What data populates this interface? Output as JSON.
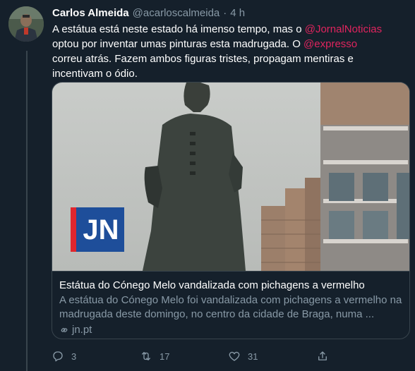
{
  "tweet": {
    "author_name": "Carlos Almeida",
    "author_handle": "@acarloscalmeida",
    "separator": "·",
    "time": "4 h",
    "text_parts": [
      "A estátua está neste estado há imenso tempo, mas o ",
      "@JornalNoticias",
      " optou por inventar umas pinturas esta madrugada. O ",
      "@expresso",
      " correu atrás. Fazem ambos figuras tristes, propagam mentiras e incentivam o ódio."
    ],
    "mention_color": "#e0245e"
  },
  "card": {
    "logo_text": "JN",
    "title": "Estátua do Cónego Melo vandalizada com pichagens a vermelho",
    "description": "A estátua do Cónego Melo foi vandalizada com pichagens a vermelho na madrugada deste domingo, no centro da cidade de Braga, numa ...",
    "link": "jn.pt",
    "link_icon": "link-icon"
  },
  "actions": {
    "reply_count": "3",
    "retweet_count": "17",
    "like_count": "31",
    "reply_icon": "reply-icon",
    "retweet_icon": "retweet-icon",
    "like_icon": "heart-icon",
    "share_icon": "share-icon"
  },
  "colors": {
    "background": "#15202b",
    "muted": "#8899a6",
    "border": "#38444d",
    "accent": "#e0245e"
  }
}
